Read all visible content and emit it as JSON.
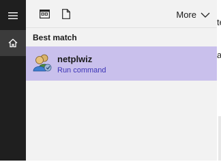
{
  "window": {
    "background": "#f2f2f2",
    "rail_color": "#1f1f1f",
    "accent_selected": "#c9c0ec",
    "subtitle_color": "#3b33b5"
  },
  "toolbar": {
    "icons": [
      "apps-icon",
      "document-icon"
    ],
    "more_label": "More",
    "more_icon": "chevron-down-icon"
  },
  "sidebar": {
    "items": [
      {
        "icon": "hamburger-menu-icon"
      },
      {
        "icon": "home-icon",
        "selected": true
      }
    ]
  },
  "results": {
    "section_title": "Best match",
    "items": [
      {
        "name": "netplwiz",
        "type": "Run command",
        "icon": "users-icon",
        "selected": true
      }
    ]
  },
  "background_window": {
    "text_fragment_1": "te",
    "text_fragment_2": "a"
  }
}
